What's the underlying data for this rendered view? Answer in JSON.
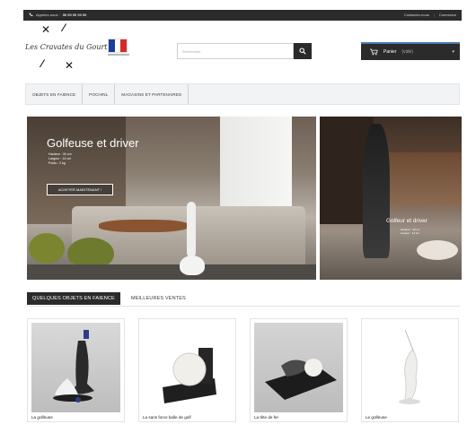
{
  "topbar": {
    "phone_label": "Appelez-nous :",
    "phone_number": "06 00 00 00 00",
    "contact_label": "Contactez-nous",
    "signin_label": "Connexion"
  },
  "header": {
    "logo_text": "Les Cravates du Gourt",
    "search_placeholder": "Rechercher",
    "cart_label": "Panier",
    "cart_count": "(vide)"
  },
  "nav": {
    "items": [
      {
        "label": "OBJETS EN FAIENCE"
      },
      {
        "label": "POCHINL"
      },
      {
        "label": "MAGASINS ET PARTENAIRES"
      }
    ]
  },
  "banners": {
    "left_title": "Golfeuse et driver",
    "left_spec_1": "Hauteur : 30 cm",
    "left_spec_2": "Largeur : 14 cm",
    "left_spec_3": "Poids : 2 kg",
    "left_cta": "ACHETER MAINTENANT !",
    "right_title": "Golfeur et driver",
    "right_spec_1": "Hauteur : 40 cm",
    "right_spec_2": "Largeur : 14 cm"
  },
  "tabs": {
    "active": "QUELQUES OBJETS EN FAIENCE",
    "inactive": "MEILLEURES VENTES"
  },
  "products": [
    {
      "name": "La golfeuse"
    },
    {
      "name": "La sans force balle de golf"
    },
    {
      "name": "La tête de fer"
    },
    {
      "name": "Le golfeuse"
    }
  ],
  "colors": {
    "dark_bar": "#2b2b2b",
    "nav_bg": "#f1f3f5",
    "accent_blue": "#4a7aa8",
    "flag_blue": "#1f3c99",
    "flag_white": "#ffffff",
    "flag_red": "#d62b2b"
  }
}
